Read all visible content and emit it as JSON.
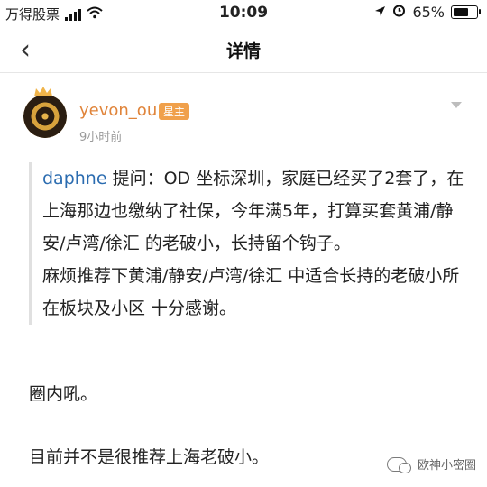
{
  "status_bar": {
    "carrier": "万得股票",
    "time": "10:09",
    "battery_percent": "65%",
    "battery_level": 0.65
  },
  "nav": {
    "back_icon": "chevron-left",
    "title": "详情"
  },
  "post": {
    "author": "yevon_ou",
    "badge": "星主",
    "time_ago": "9小时前",
    "quote": {
      "username": "daphne",
      "asked_label": " 提问：",
      "paragraph1": "OD 坐标深圳，家庭已经买了2套了，在上海那边也缴纳了社保，今年满5年，打算买套黄浦/静安/卢湾/徐汇 的老破小，长持留个钩子。",
      "paragraph2": "麻烦推荐下黄浦/静安/卢湾/徐汇 中适合长持的老破小所在板块及小区 十分感谢。"
    },
    "reply_line1": "圈内吼。",
    "reply_line2": "目前并不是很推荐上海老破小。"
  },
  "watermark": {
    "text": "欧神小密圈",
    "icon": "wechat-icon"
  }
}
